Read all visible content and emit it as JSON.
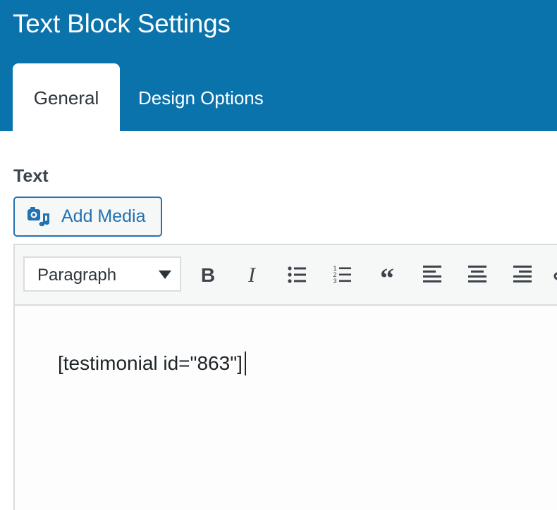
{
  "dialog": {
    "title": "Text Block Settings",
    "tabs": [
      {
        "label": "General",
        "active": true
      },
      {
        "label": "Design Options",
        "active": false
      }
    ]
  },
  "field": {
    "label": "Text"
  },
  "media_button": {
    "label": "Add Media",
    "icon": "add-media-icon"
  },
  "toolbar": {
    "format_select": {
      "selected": "Paragraph",
      "options_visible": [
        "Paragraph"
      ]
    },
    "buttons": [
      {
        "name": "bold",
        "icon": "bold-icon"
      },
      {
        "name": "italic",
        "icon": "italic-icon"
      },
      {
        "name": "bulleted-list",
        "icon": "bulleted-list-icon"
      },
      {
        "name": "numbered-list",
        "icon": "numbered-list-icon"
      },
      {
        "name": "blockquote",
        "icon": "blockquote-icon"
      },
      {
        "name": "align-left",
        "icon": "align-left-icon"
      },
      {
        "name": "align-center",
        "icon": "align-center-icon"
      },
      {
        "name": "align-right",
        "icon": "align-right-icon"
      },
      {
        "name": "link",
        "icon": "link-icon"
      }
    ]
  },
  "editor": {
    "content": "[testimonial id=\"863\"]"
  },
  "colors": {
    "header_bg": "#0b73ab",
    "accent": "#2271b1",
    "toolbar_bg": "#f6f7f7",
    "border": "#dcdcde",
    "text": "#1d2327"
  }
}
